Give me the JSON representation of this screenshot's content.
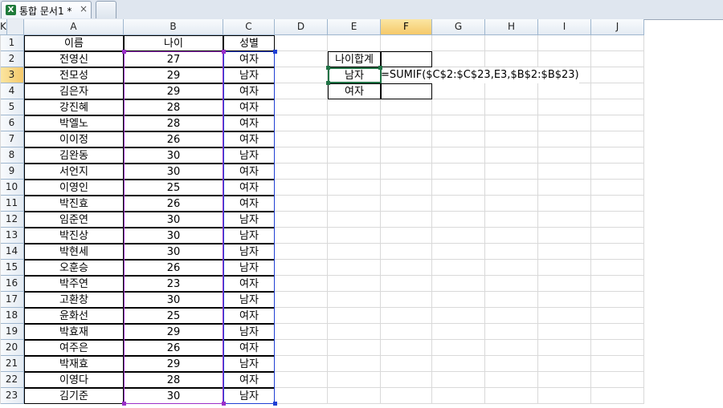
{
  "tab": {
    "title": "통합 문서1 *",
    "close": "×",
    "icon": "excel-icon"
  },
  "columns": [
    "A",
    "B",
    "C",
    "D",
    "E",
    "F",
    "G",
    "H",
    "I",
    "J",
    "K"
  ],
  "rows": [
    "1",
    "2",
    "3",
    "4",
    "5",
    "6",
    "7",
    "8",
    "9",
    "10",
    "11",
    "12",
    "13",
    "14",
    "15",
    "16",
    "17",
    "18",
    "19",
    "20",
    "21",
    "22",
    "23"
  ],
  "table": {
    "headers": [
      "이름",
      "나이",
      "성별"
    ],
    "records": [
      [
        "전영신",
        "27",
        "여자"
      ],
      [
        "전모성",
        "29",
        "남자"
      ],
      [
        "김은자",
        "29",
        "여자"
      ],
      [
        "강진혜",
        "28",
        "여자"
      ],
      [
        "박엘노",
        "28",
        "여자"
      ],
      [
        "이이정",
        "26",
        "여자"
      ],
      [
        "김완동",
        "30",
        "남자"
      ],
      [
        "서언지",
        "30",
        "여자"
      ],
      [
        "이영인",
        "25",
        "여자"
      ],
      [
        "박진효",
        "26",
        "여자"
      ],
      [
        "임준연",
        "30",
        "남자"
      ],
      [
        "박진상",
        "30",
        "남자"
      ],
      [
        "박현세",
        "30",
        "남자"
      ],
      [
        "오훈승",
        "26",
        "남자"
      ],
      [
        "박주연",
        "23",
        "여자"
      ],
      [
        "고환창",
        "30",
        "남자"
      ],
      [
        "윤화선",
        "25",
        "여자"
      ],
      [
        "박효재",
        "29",
        "남자"
      ],
      [
        "여주은",
        "26",
        "여자"
      ],
      [
        "박재효",
        "29",
        "남자"
      ],
      [
        "이영다",
        "28",
        "여자"
      ],
      [
        "김기준",
        "30",
        "남자"
      ]
    ]
  },
  "summary": {
    "label_total": "나이합계",
    "label_male": "남자",
    "label_female": "여자"
  },
  "formula": "=SUMIF($C$2:$C$23,E3,$B$2:$B$23)",
  "colors": {
    "accent": "#217346",
    "ref_b": "#9b30c9",
    "ref_c": "#1f3fd4",
    "header_sel": "#f5c96a"
  }
}
